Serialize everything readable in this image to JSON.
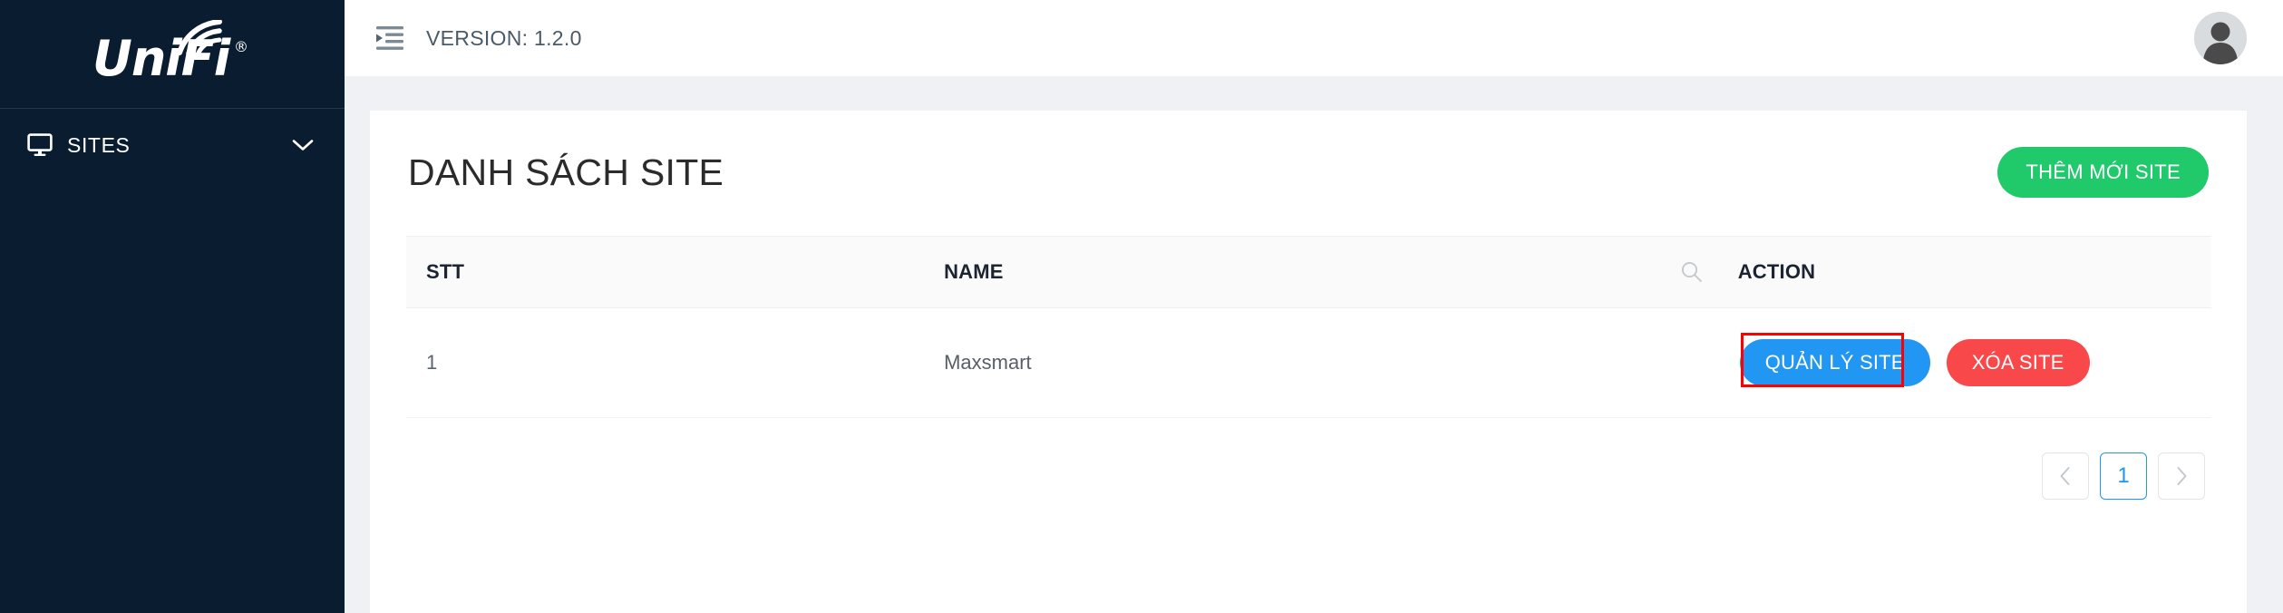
{
  "colors": {
    "sidebar_bg": "#0a1c30",
    "accent_green": "#20c96a",
    "accent_blue": "#2196f3",
    "accent_red": "#f9484a",
    "highlight_ring": "#ff0000",
    "page_bg": "#eff1f4"
  },
  "sidebar": {
    "logo_text": "UniFi",
    "logo_registered": "®",
    "logo_icon": "wifi-arcs-icon",
    "items": [
      {
        "label": "SITES",
        "icon": "monitor-icon",
        "chevron": "chevron-down-icon"
      }
    ]
  },
  "topbar": {
    "collapse_icon": "menu-collapse-left-icon",
    "version_label": "VERSION: 1.2.0",
    "avatar_icon": "user-avatar-icon"
  },
  "main": {
    "page_title": "DANH SÁCH SITE",
    "add_button_label": "THÊM MỚI SITE",
    "table": {
      "columns": [
        "STT",
        "NAME",
        "ACTION"
      ],
      "search_icon": "search-icon",
      "rows": [
        {
          "stt": "1",
          "name": "Maxsmart",
          "manage_label": "QUẢN LÝ SITE",
          "delete_label": "XÓA SITE"
        }
      ]
    },
    "pagination": {
      "prev_icon": "chevron-left-icon",
      "next_icon": "chevron-right-icon",
      "pages": [
        "1"
      ],
      "active_page": "1"
    }
  }
}
